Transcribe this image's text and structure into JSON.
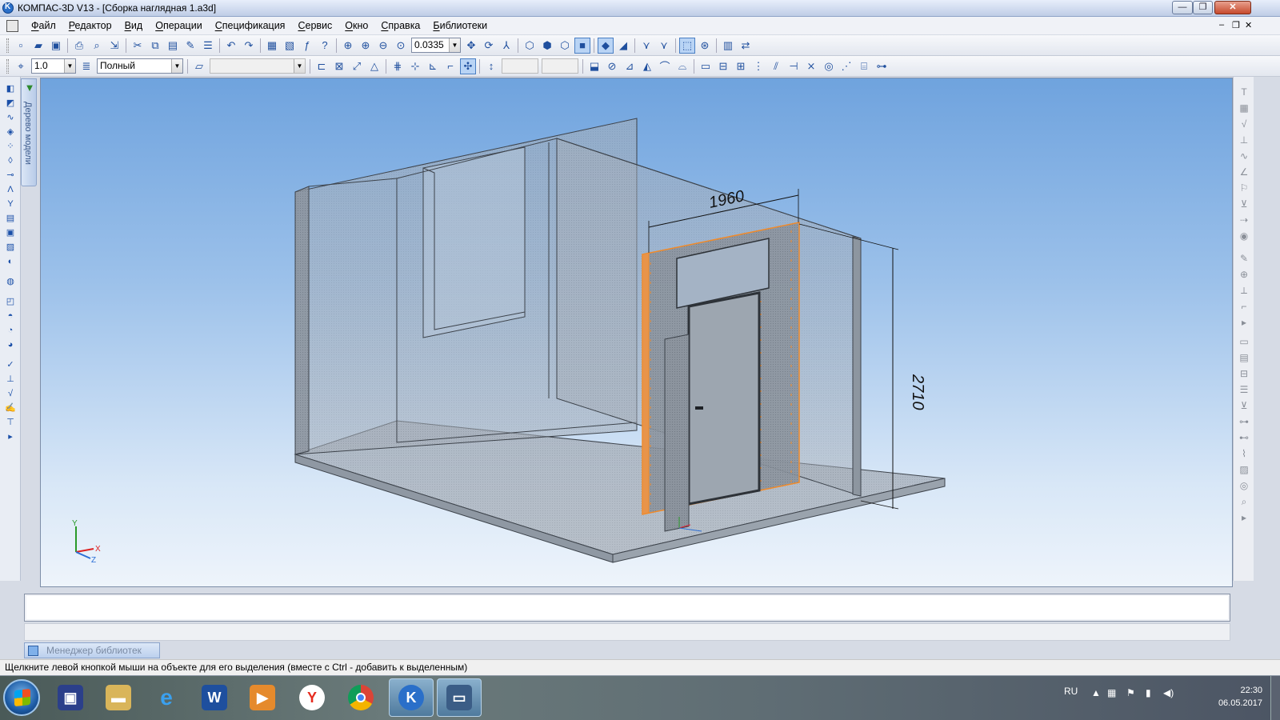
{
  "window": {
    "title": "КОМПАС-3D V13 - [Сборка наглядная 1.a3d]",
    "minimize": "—",
    "maximize": "❐",
    "close": "✕"
  },
  "menu": {
    "items": [
      "Файл",
      "Редактор",
      "Вид",
      "Операции",
      "Спецификация",
      "Сервис",
      "Окно",
      "Справка",
      "Библиотеки"
    ],
    "mdi_minimize": "–",
    "mdi_restore": "❐",
    "mdi_close": "✕"
  },
  "toolbar1": {
    "zoom_value": "0.0335"
  },
  "toolbar2": {
    "step_value": "1.0",
    "style_value": "Полный",
    "layer_value": "",
    "x_value": "",
    "y_value": ""
  },
  "tree_tab": {
    "label": "Дерево модели"
  },
  "model": {
    "dim_width": "1960",
    "dim_height": "2710",
    "axis_x": "X",
    "axis_y": "Y",
    "axis_z": "Z"
  },
  "library_manager": {
    "label": "Менеджер библиотек"
  },
  "status": {
    "text": "Щелкните левой кнопкой мыши на объекте для его выделения (вместе с Ctrl - добавить к выделенным)"
  },
  "taskbar": {
    "language": "RU",
    "time": "22:30",
    "date": "06.05.2017"
  },
  "colors": {
    "viewport_top": "#6fa3de",
    "selection_orange": "#f08a2a",
    "wall_gray": "#9aa3ad"
  }
}
